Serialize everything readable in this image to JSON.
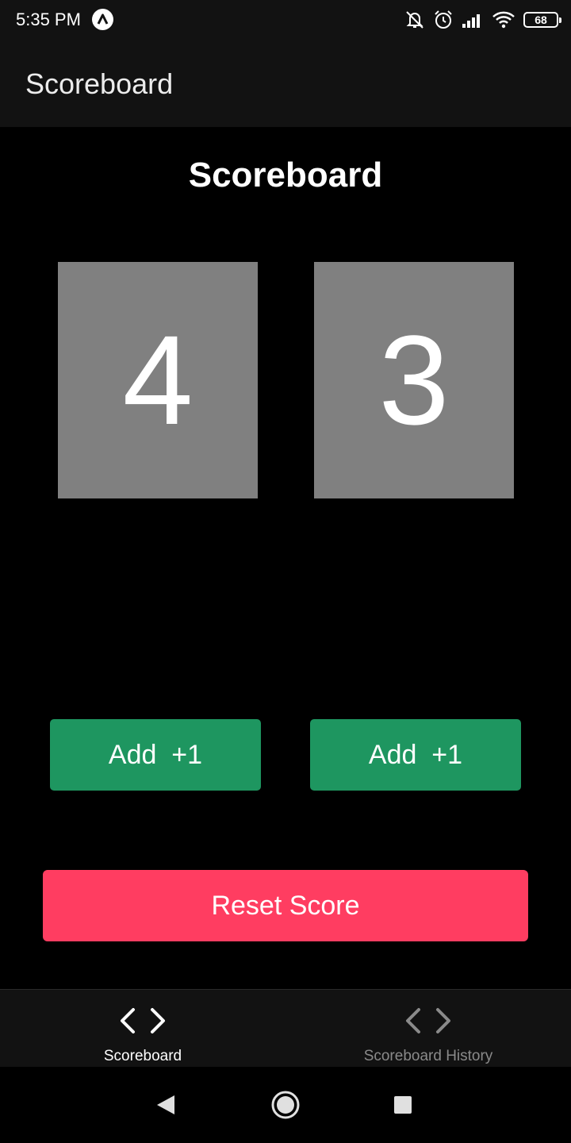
{
  "status_bar": {
    "time": "5:35 PM",
    "battery_level": "68",
    "icons": [
      "app-notification-icon",
      "mute-icon",
      "alarm-icon",
      "signal-icon",
      "wifi-icon",
      "battery-icon"
    ]
  },
  "app_bar": {
    "title": "Scoreboard"
  },
  "main": {
    "title": "Scoreboard",
    "scores": [
      {
        "value": "4"
      },
      {
        "value": "3"
      }
    ],
    "add_buttons": [
      {
        "label": "Add  +1"
      },
      {
        "label": "Add  +1"
      }
    ],
    "reset_label": "Reset Score"
  },
  "tabs": [
    {
      "label": "Scoreboard",
      "icon": "code-icon",
      "active": true
    },
    {
      "label": "Scoreboard History",
      "icon": "code-icon",
      "active": false
    }
  ],
  "nav_bar": {
    "buttons": [
      "back-icon",
      "home-icon",
      "recents-icon"
    ]
  },
  "colors": {
    "background": "#000000",
    "bar": "#121212",
    "score_box": "#808080",
    "add_button": "#1e9660",
    "reset_button": "#ff3d61",
    "tab_active": "#ffffff",
    "tab_inactive": "#8a8a8a"
  }
}
